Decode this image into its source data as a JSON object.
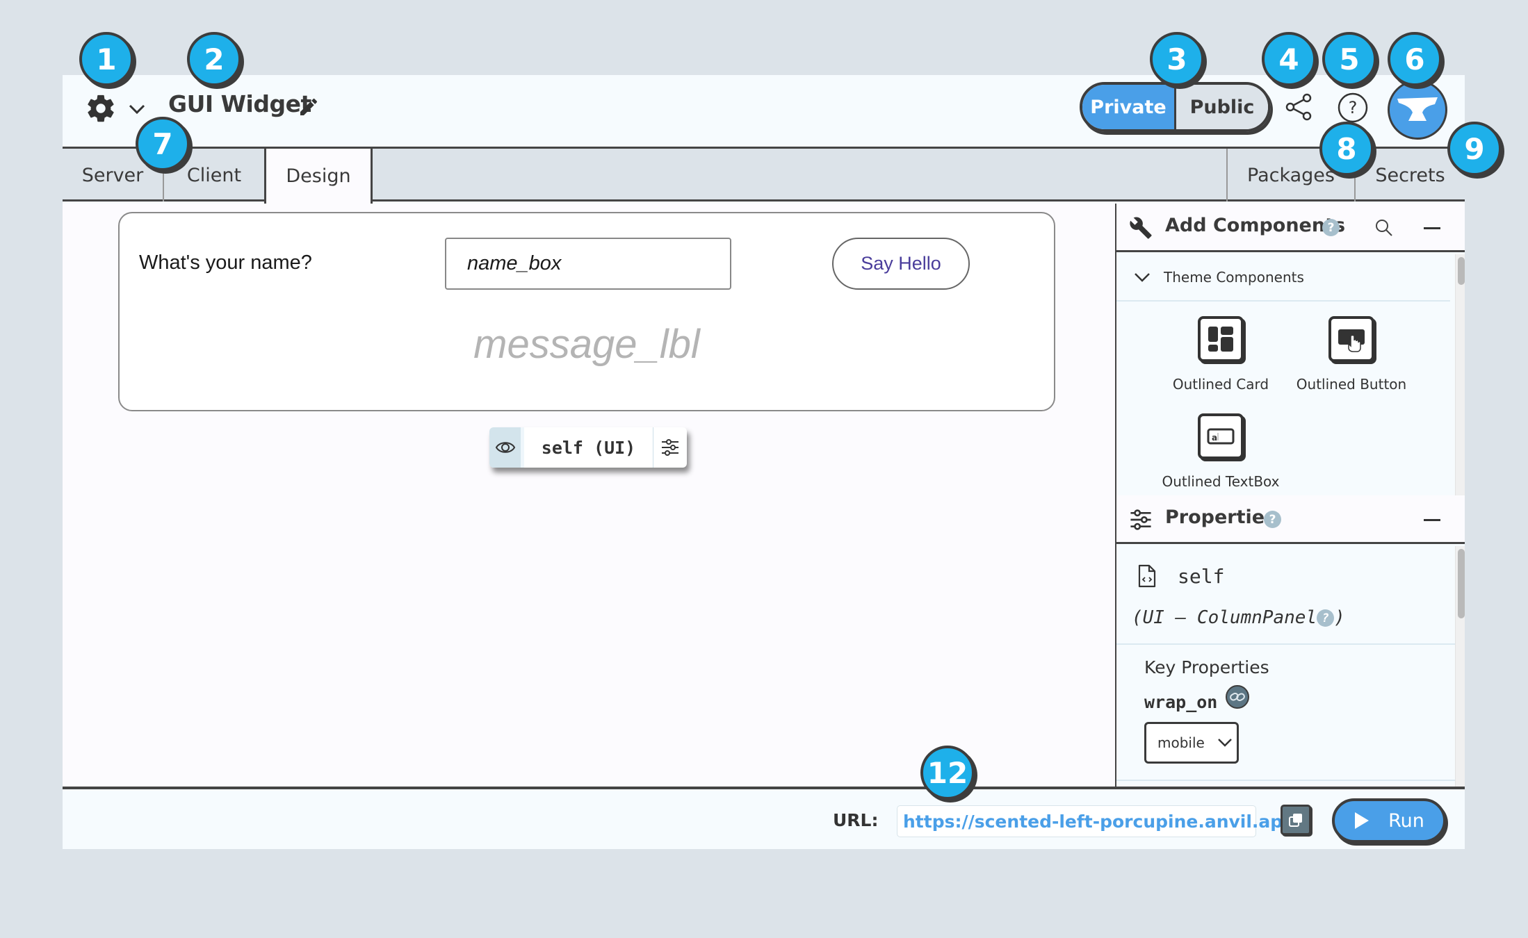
{
  "header": {
    "settings_icon": "gear-icon",
    "menu_caret_icon": "chevron-down-icon",
    "app_title": "GUI Widget",
    "edit_icon": "pencil-icon",
    "visibility_toggle": {
      "options": [
        "Private",
        "Public"
      ],
      "selected": "Private"
    },
    "share_icon": "share-icon",
    "help_icon": "question-circle-icon",
    "logo_icon": "anvil-icon"
  },
  "tabs": {
    "left": [
      {
        "label": "Server",
        "active": false
      },
      {
        "label": "Client",
        "active": false
      },
      {
        "label": "Design",
        "active": true
      }
    ],
    "right": [
      {
        "label": "Packages"
      },
      {
        "label": "Secrets"
      }
    ]
  },
  "canvas": {
    "form_label": "What's your name?",
    "name_box_value": "name_box",
    "button_label": "Say Hello",
    "message_label": "message_lbl",
    "selected_chip": "self (UI)"
  },
  "add_components": {
    "title": "Add Components",
    "section": "Theme Components",
    "items": [
      {
        "label": "Outlined Card",
        "icon": "outlined-card-icon"
      },
      {
        "label": "Outlined Button",
        "icon": "outlined-button-icon"
      },
      {
        "label": "Outlined TextBox",
        "icon": "outlined-textbox-icon"
      }
    ]
  },
  "properties": {
    "title": "Properties",
    "component_name": "self",
    "component_type_prefix": "(UI – ColumnPanel",
    "component_type_suffix": ")",
    "section": "Key Properties",
    "prop_name": "wrap_on",
    "prop_value": "mobile"
  },
  "footer": {
    "url_label": "URL:",
    "url_value": "https://scented-left-porcupine.anvil.app",
    "run_label": "Run"
  },
  "callouts": [
    "1",
    "2",
    "3",
    "4",
    "5",
    "6",
    "7",
    "8",
    "9",
    "12"
  ],
  "colors": {
    "accent": "#4a9fe8",
    "callout": "#1eb0ea",
    "button_text": "#4a3d9b"
  }
}
